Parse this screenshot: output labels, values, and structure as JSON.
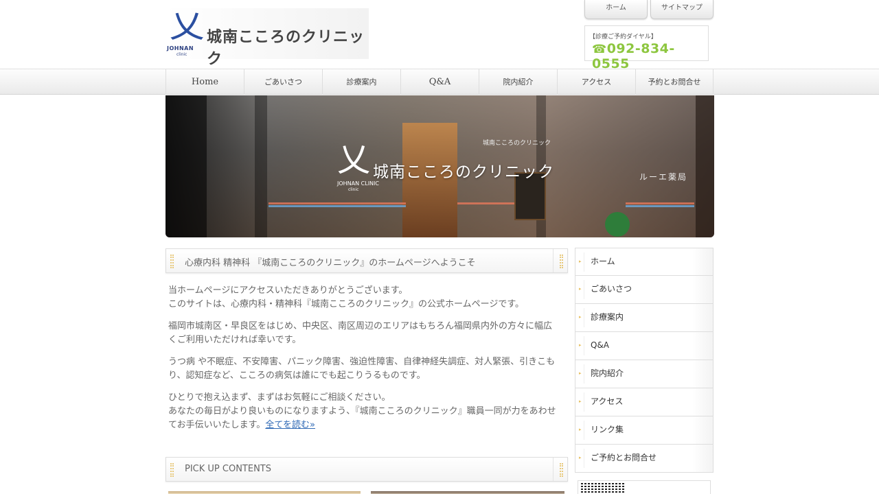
{
  "header": {
    "logo_mark_sub1": "JOHNAN",
    "logo_mark_sub2": "clinic",
    "site_title": "城南こころのクリニック",
    "top_tabs": [
      "ホーム",
      "サイトマップ"
    ],
    "phone_label": "【診療ご予約ダイヤル】",
    "phone_icon": "☎",
    "phone_number": "092-834-0555",
    "phone_color": "#8dc63f"
  },
  "nav": {
    "items": [
      "Home",
      "ごあいさつ",
      "診療案内",
      "Q&A",
      "院内紹介",
      "アクセス",
      "予約とお問合せ"
    ]
  },
  "hero": {
    "title": "城南こころのクリニック",
    "logo_sub1": "JOHNAN CLINIC",
    "logo_sub2": "clinic",
    "window_sign": "城南こころのクリニック",
    "pharmacy": "ルーエ薬局"
  },
  "main": {
    "welcome_title": "心療内科 精神科 『城南こころのクリニック』のホームページへようこそ",
    "paragraphs": [
      "当ホームページにアクセスいただきありがとうございます。",
      "このサイトは、心療内科・精神科『城南こころのクリニック』の公式ホームページです。",
      "福岡市城南区・早良区をはじめ、中央区、南区周辺のエリアはもちろん福岡県内外の方々に幅広くご利用いただければ幸いです。",
      "うつ病 や不眠症、不安障害、パニック障害、強迫性障害、自律神経失調症、対人緊張、引きこもり、認知症など、こころの病気は誰にでも起こりうるものです。",
      "ひとりで抱え込まず、まずはお気軽にご相談ください。",
      "あなたの毎日がより良いものになりますよう、『城南こころのクリニック』職員一同が力をあわせてお手伝いいたします。"
    ],
    "read_more": "全てを読む»",
    "pickup_title": "PICK UP CONTENTS"
  },
  "sidebar": {
    "items": [
      "ホーム",
      "ごあいさつ",
      "診療案内",
      "Q&A",
      "院内紹介",
      "アクセス",
      "リンク集",
      "ご予約とお問合せ"
    ],
    "arrow_icon": "▸"
  }
}
